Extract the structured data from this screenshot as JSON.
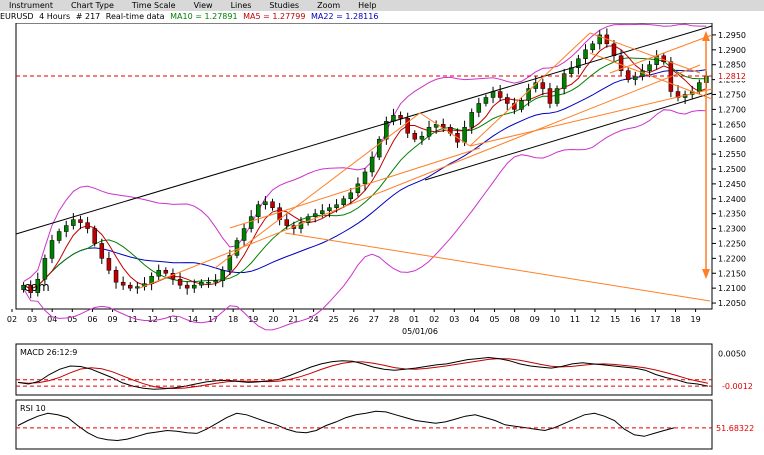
{
  "menu": {
    "items": [
      "Instrument",
      "Chart Type",
      "Time Scale",
      "View",
      "Lines",
      "Studies",
      "Zoom",
      "Help"
    ]
  },
  "header": {
    "symbol": "EURUSD",
    "interval": "4 Hours",
    "bars": "# 217",
    "mode": "Real-time data",
    "ma10_label": "MA10 = 1.27891",
    "ma5_label": "MA5 = 1.27799",
    "ma22_label": "MA22 = 1.28116"
  },
  "watermark": "com",
  "colors": {
    "ma10": "#008000",
    "ma5": "#c00000",
    "ma22": "#0000c0",
    "bollinger": "#cc33cc",
    "trend_orange": "#ff7f27",
    "channel": "#000000",
    "level_red": "#e00000",
    "candle_up": "#008000",
    "candle_down": "#c00000"
  },
  "price_axis": {
    "ticks": [
      "1.2950",
      "1.2900",
      "1.2850",
      "1.2800",
      "1.2750",
      "1.2700",
      "1.2650",
      "1.2600",
      "1.2550",
      "1.2500",
      "1.2450",
      "1.2400",
      "1.2350",
      "1.2300",
      "1.2250",
      "1.2200",
      "1.2150",
      "1.2100",
      "1.2050"
    ],
    "current_price": "1.2812",
    "ylim": [
      1.203,
      1.299
    ]
  },
  "date_axis": {
    "ticks": [
      "02",
      "03",
      "04",
      "05",
      "06",
      "09",
      "11",
      "12",
      "13",
      "14",
      "17",
      "18",
      "19",
      "20",
      "21",
      "24",
      "25",
      "26",
      "27",
      "28",
      "01",
      "02",
      "03",
      "04",
      "05",
      "08",
      "09",
      "10",
      "11",
      "12",
      "15",
      "16",
      "17",
      "18",
      "19"
    ],
    "month_label": "05/01/06"
  },
  "macd": {
    "label": "MACD 26:12:9",
    "ticks": [
      "0.0050"
    ],
    "current_value": "-0.0012"
  },
  "rsi": {
    "label": "RSI 10",
    "current_value": "51.68322"
  },
  "chart_data": {
    "type": "candlestick",
    "symbol": "EURUSD",
    "interval": "4 Hours",
    "ylim": [
      1.203,
      1.299
    ],
    "closes": [
      1.211,
      1.2085,
      1.213,
      1.22,
      1.226,
      1.229,
      1.231,
      1.233,
      1.232,
      1.23,
      1.225,
      1.22,
      1.216,
      1.212,
      1.211,
      1.21,
      1.2105,
      1.2115,
      1.214,
      1.216,
      1.215,
      1.213,
      1.211,
      1.21,
      1.211,
      1.212,
      1.212,
      1.2125,
      1.216,
      1.221,
      1.226,
      1.23,
      1.234,
      1.238,
      1.239,
      1.237,
      1.233,
      1.231,
      1.23,
      1.232,
      1.234,
      1.235,
      1.236,
      1.237,
      1.238,
      1.24,
      1.242,
      1.245,
      1.249,
      1.254,
      1.26,
      1.266,
      1.268,
      1.267,
      1.262,
      1.26,
      1.261,
      1.264,
      1.265,
      1.264,
      1.262,
      1.259,
      1.264,
      1.269,
      1.272,
      1.274,
      1.276,
      1.274,
      1.272,
      1.27,
      1.273,
      1.277,
      1.279,
      1.277,
      1.272,
      1.277,
      1.282,
      1.284,
      1.287,
      1.29,
      1.292,
      1.295,
      1.292,
      1.288,
      1.283,
      1.28,
      1.281,
      1.283,
      1.285,
      1.288,
      1.286,
      1.276,
      1.274,
      1.275,
      1.276,
      1.279,
      1.2812
    ],
    "overlays": [
      "MA5",
      "MA10",
      "MA22",
      "Bollinger Bands"
    ],
    "macd_values": [
      -0.0005,
      -0.0008,
      -0.0003,
      0.001,
      0.002,
      0.0026,
      0.0025,
      0.002,
      0.0012,
      0.0004,
      -0.0006,
      -0.0012,
      -0.0016,
      -0.0018,
      -0.0017,
      -0.0015,
      -0.0012,
      -0.0008,
      -0.0004,
      -0.0002,
      -0.0001,
      -0.0003,
      -0.0005,
      -0.0004,
      -0.0002,
      0.0001,
      0.0008,
      0.0016,
      0.0024,
      0.003,
      0.0034,
      0.0036,
      0.0035,
      0.003,
      0.0024,
      0.002,
      0.0018,
      0.002,
      0.0022,
      0.0025,
      0.0028,
      0.003,
      0.0034,
      0.0038,
      0.004,
      0.0042,
      0.004,
      0.0036,
      0.003,
      0.0026,
      0.0024,
      0.0022,
      0.0025,
      0.003,
      0.0032,
      0.003,
      0.0028,
      0.0026,
      0.0024,
      0.0022,
      0.0018,
      0.001,
      0.0004,
      0.0,
      -0.0006,
      -0.0008,
      -0.0012
    ],
    "rsi_values": [
      55,
      62,
      68,
      72,
      70,
      66,
      55,
      45,
      38,
      35,
      34,
      36,
      40,
      44,
      46,
      48,
      47,
      45,
      44,
      50,
      58,
      66,
      72,
      70,
      65,
      60,
      56,
      50,
      46,
      45,
      48,
      55,
      60,
      66,
      70,
      72,
      75,
      74,
      70,
      66,
      62,
      60,
      58,
      60,
      64,
      68,
      70,
      66,
      62,
      56,
      54,
      52,
      50,
      48,
      52,
      58,
      64,
      70,
      72,
      68,
      62,
      50,
      42,
      40,
      44,
      48,
      51.68
    ]
  }
}
